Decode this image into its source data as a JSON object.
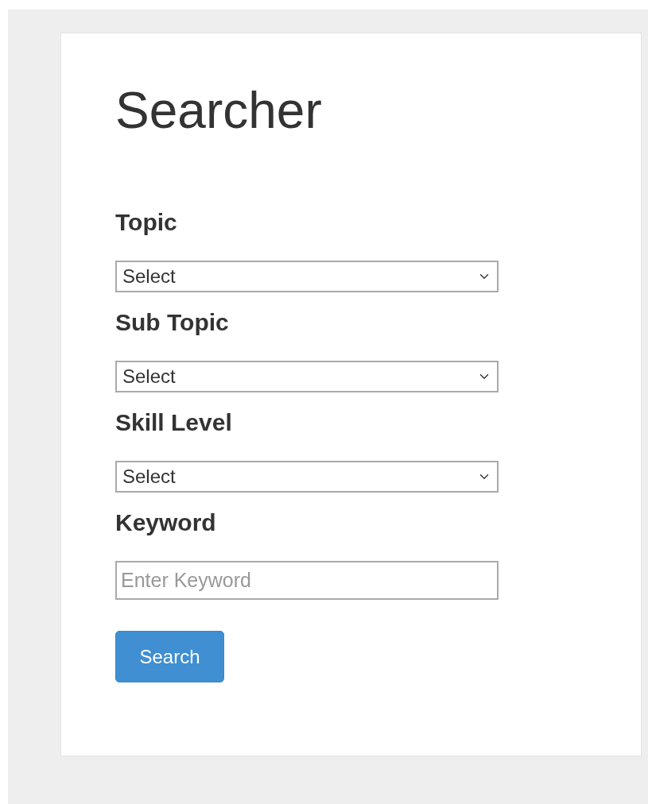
{
  "title": "Searcher",
  "fields": [
    {
      "label": "Topic",
      "kind": "select",
      "value": "Select"
    },
    {
      "label": "Sub Topic",
      "kind": "select",
      "value": "Select"
    },
    {
      "label": "Skill Level",
      "kind": "select",
      "value": "Select"
    },
    {
      "label": "Keyword",
      "kind": "text",
      "placeholder": "Enter Keyword"
    }
  ],
  "button": "Search"
}
